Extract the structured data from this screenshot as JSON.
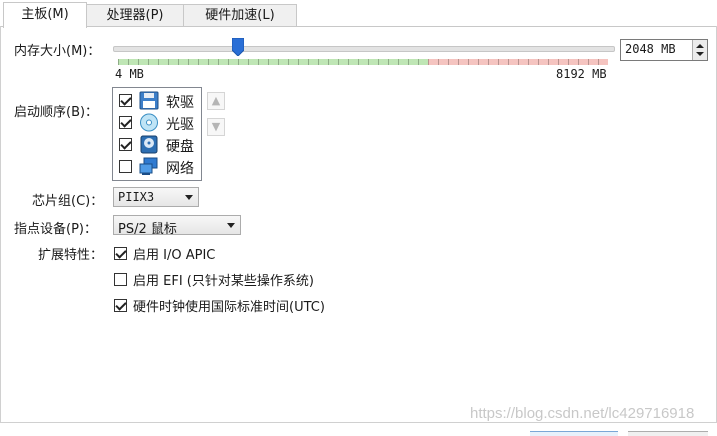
{
  "tabs": [
    {
      "label": "主板(M)",
      "active": true
    },
    {
      "label": "处理器(P)",
      "active": false
    },
    {
      "label": "硬件加速(L)",
      "active": false
    }
  ],
  "memory": {
    "label": "内存大小(M)：",
    "value_mb": 2048,
    "value_text": "2048 MB",
    "min_label": "4 MB",
    "max_label": "8192 MB",
    "min_mb": 4,
    "max_mb": 8192
  },
  "boot_order": {
    "label": "启动顺序(B)：",
    "items": [
      {
        "label": "软驱",
        "checked": true,
        "icon": "floppy-icon"
      },
      {
        "label": "光驱",
        "checked": true,
        "icon": "optical-disc-icon"
      },
      {
        "label": "硬盘",
        "checked": true,
        "icon": "hard-disk-icon"
      },
      {
        "label": "网络",
        "checked": false,
        "icon": "network-icon"
      }
    ],
    "move_up_icon": "arrow-up-icon",
    "move_down_icon": "arrow-down-icon"
  },
  "chipset": {
    "label": "芯片组(C)：",
    "value": "PIIX3"
  },
  "pointing_device": {
    "label": "指点设备(P)：",
    "value": "PS/2 鼠标"
  },
  "extended": {
    "label": "扩展特性：",
    "options": [
      {
        "label": "启用 I/O APIC",
        "checked": true
      },
      {
        "label": "启用 EFI (只针对某些操作系统)",
        "checked": false
      },
      {
        "label": "硬件时钟使用国际标准时间(UTC)",
        "checked": true
      }
    ]
  },
  "watermark": "https://blog.csdn.net/lc429716918",
  "colors": {
    "accent": "#2a6fd6",
    "scale_green": "#bfe6b5",
    "scale_red": "#f5c4c0"
  }
}
